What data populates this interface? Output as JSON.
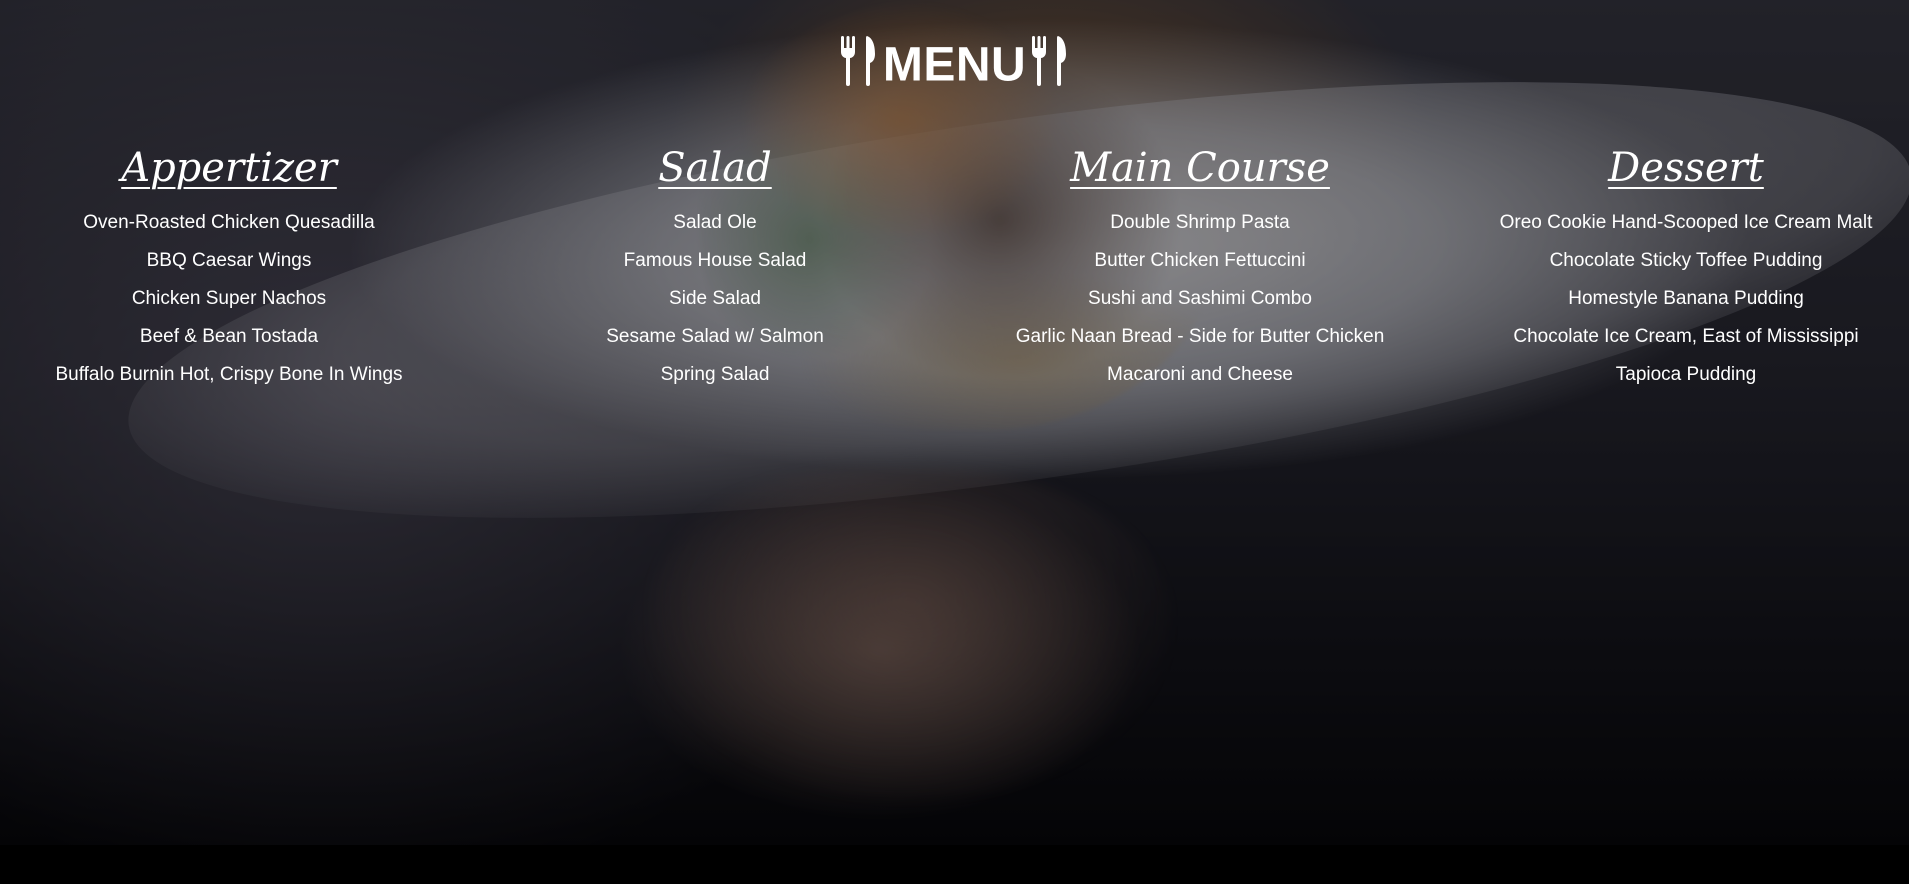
{
  "page": {
    "title_text": "MENU",
    "left_icon": "fork-knife-icon",
    "right_icon": "fork-knife-icon"
  },
  "colors": {
    "text": "#ffffff",
    "overlay": "rgba(0,0,0,0.42)",
    "bottom_bar": "#000000"
  },
  "background": {
    "image_subject": "chef holding plate of food",
    "image_icon": "food-plate-image"
  },
  "sections": [
    {
      "heading": "Appertizer",
      "items": [
        "Oven-Roasted Chicken Quesadilla",
        "BBQ Caesar Wings",
        "Chicken Super Nachos",
        "Beef & Bean Tostada",
        "Buffalo Burnin Hot, Crispy Bone In Wings"
      ]
    },
    {
      "heading": "Salad",
      "items": [
        "Salad Ole",
        "Famous House Salad",
        "Side Salad",
        "Sesame Salad w/ Salmon",
        "Spring Salad"
      ]
    },
    {
      "heading": "Main Course",
      "items": [
        "Double Shrimp Pasta",
        "Butter Chicken Fettuccini",
        "Sushi and Sashimi Combo",
        "Garlic Naan Bread - Side for Butter Chicken",
        "Macaroni and Cheese"
      ]
    },
    {
      "heading": "Dessert",
      "items": [
        "Oreo Cookie Hand-Scooped Ice Cream Malt",
        "Chocolate Sticky Toffee Pudding",
        "Homestyle Banana Pudding",
        "Chocolate Ice Cream, East of Mississippi",
        "Tapioca Pudding"
      ]
    }
  ]
}
